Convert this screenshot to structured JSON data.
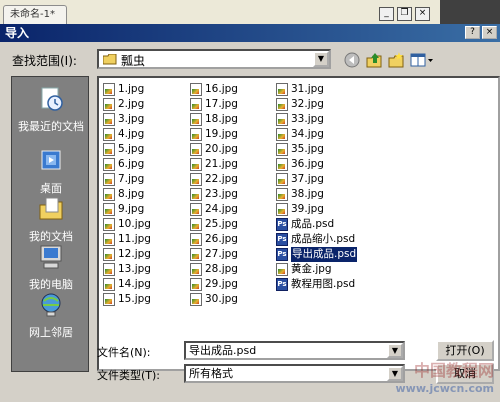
{
  "background": {
    "tab_title": "未命名-1*"
  },
  "dialog": {
    "title": "导入",
    "help_glyph": "?",
    "close_glyph": "×"
  },
  "lookin": {
    "label": "查找范围(I):",
    "value": "瓢虫"
  },
  "places": [
    {
      "label": "我最近的文档",
      "icon": "recent-documents-icon"
    },
    {
      "label": "桌面",
      "icon": "desktop-icon"
    },
    {
      "label": "我的文档",
      "icon": "my-documents-icon"
    },
    {
      "label": "我的电脑",
      "icon": "my-computer-icon"
    },
    {
      "label": "网上邻居",
      "icon": "network-icon"
    }
  ],
  "files": {
    "col1": [
      "1.jpg",
      "2.jpg",
      "3.jpg",
      "4.jpg",
      "5.jpg",
      "6.jpg",
      "7.jpg",
      "8.jpg",
      "9.jpg",
      "10.jpg",
      "11.jpg",
      "12.jpg",
      "13.jpg",
      "14.jpg",
      "15.jpg"
    ],
    "col2": [
      "16.jpg",
      "17.jpg",
      "18.jpg",
      "19.jpg",
      "20.jpg",
      "21.jpg",
      "22.jpg",
      "23.jpg",
      "24.jpg",
      "25.jpg",
      "26.jpg",
      "27.jpg",
      "28.jpg",
      "29.jpg",
      "30.jpg"
    ],
    "col3": [
      "31.jpg",
      "32.jpg",
      "33.jpg",
      "34.jpg",
      "35.jpg",
      "36.jpg",
      "37.jpg",
      "38.jpg",
      "39.jpg",
      "成品.psd",
      "成品缩小.psd",
      "导出成品.psd",
      "黄金.jpg",
      "教程用图.psd"
    ],
    "selected": "导出成品.psd"
  },
  "filename": {
    "label": "文件名(N):",
    "value": "导出成品.psd"
  },
  "filetype": {
    "label": "文件类型(T):",
    "value": "所有格式"
  },
  "buttons": {
    "open": "打开(O)",
    "cancel": "取消"
  },
  "watermark": {
    "line1": "中国教程网",
    "line2": "www.jcwcn.com"
  }
}
